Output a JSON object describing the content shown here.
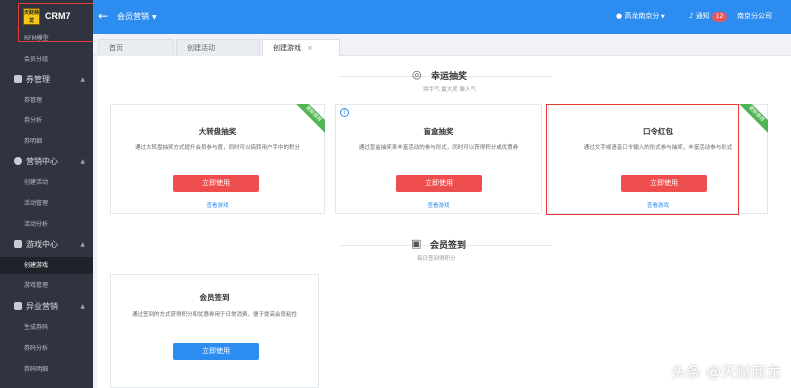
{
  "logo": {
    "badge_text": "天财商龙",
    "app_name": "CRM7"
  },
  "sidebar": {
    "items": [
      {
        "label": "RFM模型",
        "kind": "item",
        "active": false
      },
      {
        "label": "会员分组",
        "kind": "item",
        "active": false
      },
      {
        "label": "券管理",
        "kind": "group"
      },
      {
        "label": "券管理",
        "kind": "item",
        "active": false
      },
      {
        "label": "券分析",
        "kind": "item",
        "active": false
      },
      {
        "label": "券明细",
        "kind": "item",
        "active": false
      },
      {
        "label": "营销中心",
        "kind": "group"
      },
      {
        "label": "创建活动",
        "kind": "item",
        "active": false
      },
      {
        "label": "活动管理",
        "kind": "item",
        "active": false
      },
      {
        "label": "活动分析",
        "kind": "item",
        "active": false
      },
      {
        "label": "游戏中心",
        "kind": "group"
      },
      {
        "label": "创建游戏",
        "kind": "item",
        "active": true
      },
      {
        "label": "游戏管理",
        "kind": "item",
        "active": false
      },
      {
        "label": "异业营销",
        "kind": "group"
      },
      {
        "label": "生成券码",
        "kind": "item",
        "active": false
      },
      {
        "label": "券码分析",
        "kind": "item",
        "active": false
      },
      {
        "label": "券码明细",
        "kind": "item",
        "active": false
      }
    ]
  },
  "topbar": {
    "back_icon": "arrow-left-icon",
    "module_title": "会员营销",
    "user_name": "高龙南京分",
    "notice_label": "通知",
    "notice_count": "12",
    "company": "南京分公司"
  },
  "tabs": [
    {
      "label": "首页",
      "active": false,
      "closable": false
    },
    {
      "label": "创建活动",
      "active": false,
      "closable": false
    },
    {
      "label": "创建游戏",
      "active": true,
      "closable": true
    }
  ],
  "sections": {
    "lottery": {
      "title": "幸运抽奖",
      "subtitle": "拼手气 赢大奖 聚人气"
    },
    "signin": {
      "title": "会员签到",
      "subtitle": "每日签到得积分"
    }
  },
  "cards": {
    "wheel": {
      "title": "大转盘抽奖",
      "desc": "通过大转盘抽奖方式提升会员参与度，同时可以搞转用户手中的积分",
      "button": "立即使用",
      "link": "查看游戏",
      "ribbon": "更新推荐"
    },
    "blindbox": {
      "title": "盲盒抽奖",
      "desc": "通过盲盒抽奖来丰富活动的参与形式，同时可以获得积分或优惠券",
      "button": "立即使用",
      "link": "查看游戏"
    },
    "redpacket": {
      "title": "口令红包",
      "desc": "通过文字或语音口令输入的形式参与抽奖，丰富活动参与形式",
      "button": "立即使用",
      "link": "查看游戏",
      "ribbon": "更新推荐"
    },
    "signin": {
      "title": "会员签到",
      "desc": "通过签到的方式获得积分和优惠券用于日常消费，便于提高会员粘性",
      "button": "立即使用"
    }
  },
  "watermark": "头条 @天财商龙",
  "colors": {
    "primary": "#2d8cf0",
    "danger": "#ee4d4d",
    "sidebar": "#2f3440",
    "ribbon": "#52b553",
    "highlight": "#e53935"
  }
}
